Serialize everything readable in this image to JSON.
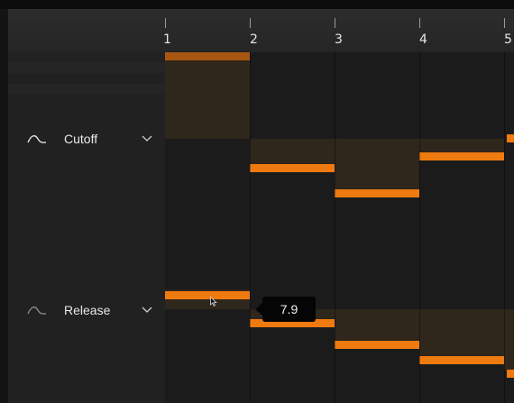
{
  "ruler": {
    "steps": [
      "1",
      "2",
      "3",
      "4",
      "5"
    ]
  },
  "lanes": [
    {
      "label": "Cutoff",
      "icon": "curve-icon",
      "menu_icon": "chevron-down-icon"
    },
    {
      "label": "Release",
      "icon": "curve-icon",
      "menu_icon": "chevron-down-icon"
    }
  ],
  "tooltip": {
    "value": "7.9"
  },
  "colors": {
    "accent": "#ef7a10",
    "cell": "#2f261c",
    "background": "#1b1b1b"
  }
}
